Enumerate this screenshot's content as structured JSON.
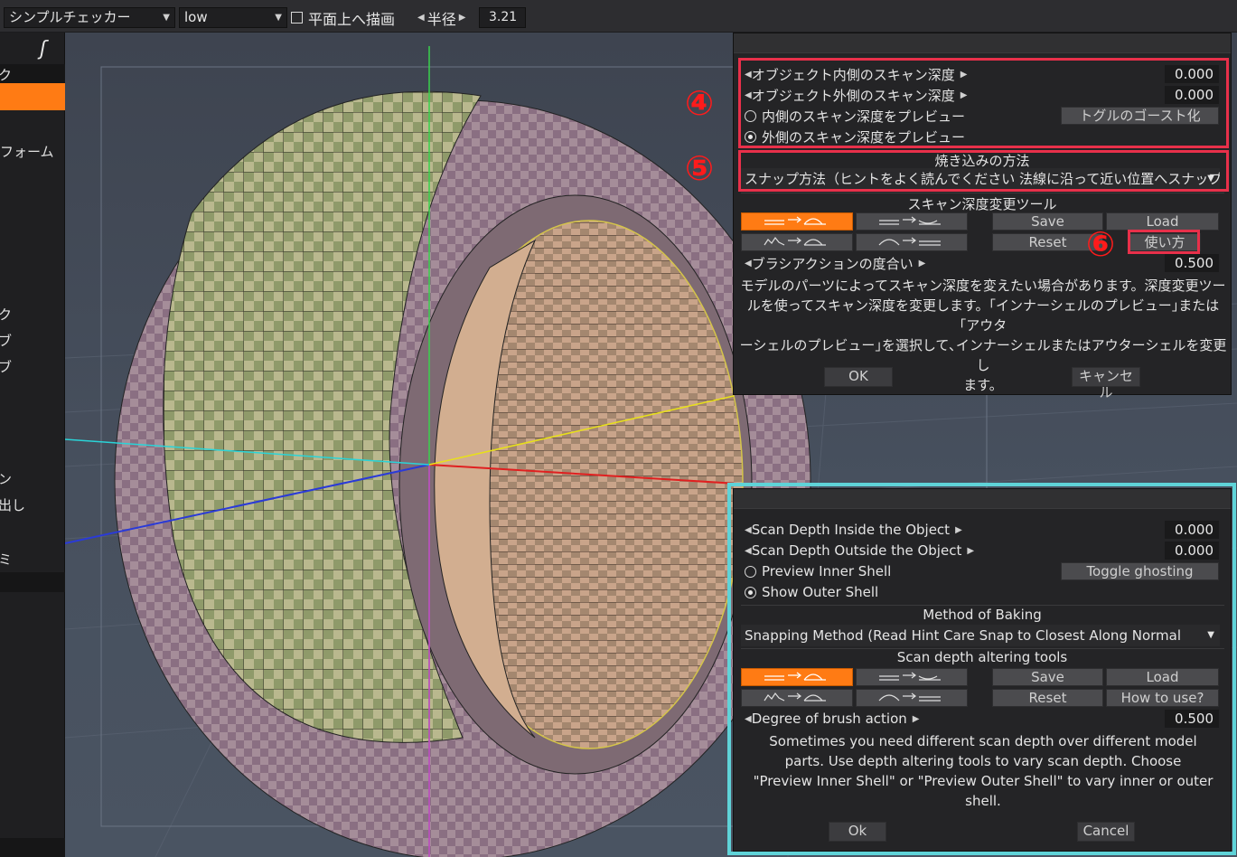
{
  "toolbar": {
    "texture_select": "シンプルチェッカー",
    "quality_select": "low",
    "draw_on_plane": "平面上へ描画",
    "radius_label": "半径",
    "radius_value": "3.21"
  },
  "sidebar": {
    "items": [
      "ク",
      "フォーム",
      "ク",
      "ブ",
      "ブ",
      "ン",
      "出し",
      "ミ"
    ]
  },
  "dialog_jp": {
    "scan_inside_label": "オブジェクト内側のスキャン深度",
    "scan_inside_value": "0.000",
    "scan_outside_label": "オブジェクト外側のスキャン深度",
    "scan_outside_value": "0.000",
    "preview_inner": "内側のスキャン深度をプレビュー",
    "preview_outer": "外側のスキャン深度をプレビュー",
    "toggle_ghost": "トグルのゴースト化",
    "baking_title": "焼き込みの方法",
    "baking_method": "スナップ方法（ヒントをよく読んでください 法線に沿って近い位置へスナップ",
    "tools_title": "スキャン深度変更ツール",
    "save": "Save",
    "load": "Load",
    "reset": "Reset",
    "how_to": "使い方",
    "brush_label": "ブラシアクションの度合い",
    "brush_value": "0.500",
    "desc_lines": [
      "モデルのパーツによってスキャン深度を変えたい場合があります。深度変更ツー",
      "ルを使ってスキャン深度を変更します。｢インナーシェルのプレビュー｣または｢アウタ",
      "ーシェルのプレビュー｣を選択して､インナーシェルまたはアウターシェルを変更し",
      "ます。"
    ],
    "ok": "OK",
    "cancel": "キャンセル"
  },
  "dialog_en": {
    "scan_inside_label": "Scan Depth Inside the Object",
    "scan_inside_value": "0.000",
    "scan_outside_label": "Scan Depth Outside the Object",
    "scan_outside_value": "0.000",
    "preview_inner": "Preview Inner Shell",
    "preview_outer": "Show Outer Shell",
    "toggle_ghost": "Toggle ghosting",
    "baking_title": "Method of Baking",
    "baking_method": "Snapping Method (Read Hint Care Snap to Closest Along Normal",
    "tools_title": "Scan depth altering tools",
    "save": "Save",
    "load": "Load",
    "reset": "Reset",
    "how_to": "How to use?",
    "brush_label": "Degree of brush action",
    "brush_value": "0.500",
    "desc_lines": [
      "Sometimes you need different scan depth over different model",
      "parts. Use depth altering tools to vary scan depth. Choose",
      "\"Preview Inner Shell\" or \"Preview Outer Shell\" to vary inner or outer",
      "shell."
    ],
    "ok": "Ok",
    "cancel": "Cancel"
  },
  "annotations": {
    "badge_4": "④",
    "badge_5": "⑤",
    "badge_6": "⑥"
  },
  "colors": {
    "accent": "#ff7b14",
    "annotation_red": "#e8304a",
    "annotation_teal": "#5fd3d8",
    "badge_red": "#ff1b1b"
  }
}
